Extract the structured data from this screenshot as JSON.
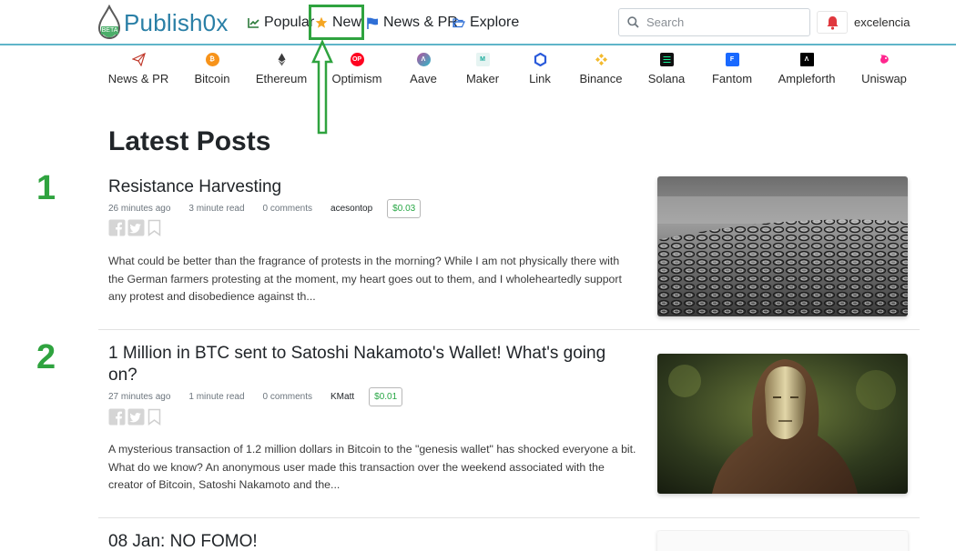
{
  "header": {
    "logo_text": "Publish0x",
    "logo_badge": "BETA",
    "nav": [
      {
        "label": "Popular",
        "icon": "chart-line-icon"
      },
      {
        "label": "New",
        "icon": "star-icon"
      },
      {
        "label": "News & PR",
        "icon": "flag-icon"
      },
      {
        "label": "Explore",
        "icon": "folder-open-icon"
      }
    ],
    "search_placeholder": "Search",
    "username": "excelencia"
  },
  "categories": [
    {
      "label": "News & PR",
      "icon": "paper-plane-icon",
      "color": "#c0392b"
    },
    {
      "label": "Bitcoin",
      "icon": "bitcoin-icon",
      "color": "#f7931a"
    },
    {
      "label": "Ethereum",
      "icon": "ethereum-icon",
      "color": "#3c3c3d"
    },
    {
      "label": "Optimism",
      "icon": "optimism-icon",
      "color": "#ff0420"
    },
    {
      "label": "Aave",
      "icon": "aave-icon",
      "color": "#8c6ad8"
    },
    {
      "label": "Maker",
      "icon": "maker-icon",
      "color": "#1aab9b"
    },
    {
      "label": "Link",
      "icon": "chainlink-icon",
      "color": "#2a5ada"
    },
    {
      "label": "Binance",
      "icon": "binance-icon",
      "color": "#f3ba2f"
    },
    {
      "label": "Solana",
      "icon": "solana-icon",
      "color": "#14f195"
    },
    {
      "label": "Fantom",
      "icon": "fantom-icon",
      "color": "#1969ff"
    },
    {
      "label": "Ampleforth",
      "icon": "ampleforth-icon",
      "color": "#000000"
    },
    {
      "label": "Uniswap",
      "icon": "uniswap-icon",
      "color": "#ff007a"
    }
  ],
  "main": {
    "title": "Latest Posts",
    "posts": [
      {
        "number": "1",
        "title": "Resistance Harvesting",
        "time": "26 minutes ago",
        "read": "3 minute read",
        "comments": "0 comments",
        "author": "acesontop",
        "earned": "$0.03",
        "excerpt": "What could be better than the fragrance of protests in the morning? While I am not physically there with the German farmers protesting at the moment, my heart goes out to them, and I wholeheartedly support any protest and disobedience against th..."
      },
      {
        "number": "2",
        "title": "1 Million in BTC sent to Satoshi Nakamoto's Wallet! What's going on?",
        "time": "27 minutes ago",
        "read": "1 minute read",
        "comments": "0 comments",
        "author": "KMatt",
        "earned": "$0.01",
        "excerpt": "A mysterious transaction of 1.2 million dollars in Bitcoin to the \"genesis wallet\" has shocked everyone a bit. What do we know? An anonymous user made this transaction over the weekend associated with the creator of Bitcoin, Satoshi Nakamoto and the..."
      },
      {
        "title": "08 Jan: NO FOMO!"
      }
    ]
  },
  "colors": {
    "annotation_green": "#2fa33f",
    "brand_blue": "#2a7fa6",
    "earn_green": "#28a745"
  }
}
